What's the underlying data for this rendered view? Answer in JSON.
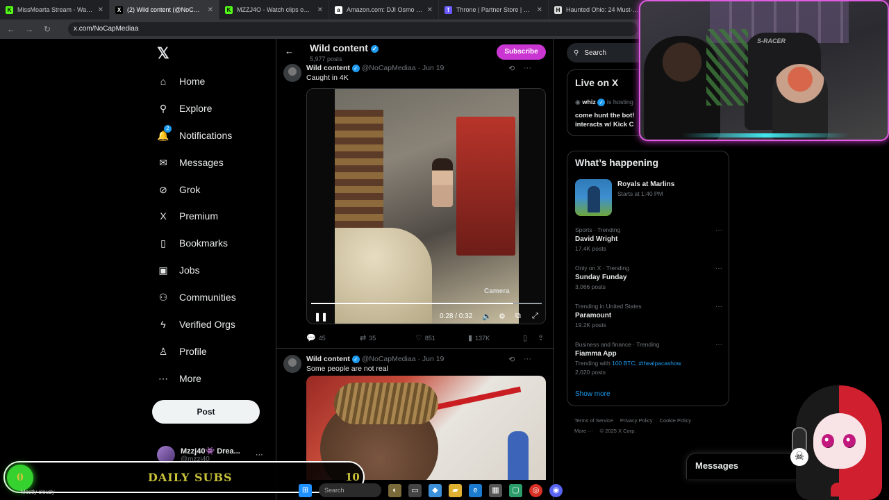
{
  "browser": {
    "tabs": [
      {
        "label": "MissMoarta Stream - Watch Live",
        "fav": "K",
        "fav_color": "#53fc18"
      },
      {
        "label": "(2) Wild content (@NoCapMediaa)",
        "fav": "X",
        "fav_color": "#000000",
        "active": true
      },
      {
        "label": "MZZJ4O - Watch clips on Kick",
        "fav": "K",
        "fav_color": "#53fc18"
      },
      {
        "label": "Amazon.com: DJI Osmo Mobile",
        "fav": "a",
        "fav_color": "#ffffff"
      },
      {
        "label": "Throne | Partner Store | Browse",
        "fav": "T",
        "fav_color": "#6b5bff"
      },
      {
        "label": "Haunted Ohio: 24 Must-Visit",
        "fav": "H",
        "fav_color": "#dddddd"
      }
    ],
    "url": "x.com/NoCapMediaa"
  },
  "nav": {
    "items": [
      {
        "label": "Home",
        "icon": "home-icon",
        "glyph": "⌂"
      },
      {
        "label": "Explore",
        "icon": "search-icon",
        "glyph": "⚲"
      },
      {
        "label": "Notifications",
        "icon": "bell-icon",
        "glyph": "🔔"
      },
      {
        "label": "Messages",
        "icon": "mail-icon",
        "glyph": "✉"
      },
      {
        "label": "Grok",
        "icon": "grok-icon",
        "glyph": "⊘"
      },
      {
        "label": "Premium",
        "icon": "x-icon",
        "glyph": "X"
      },
      {
        "label": "Bookmarks",
        "icon": "bookmark-icon",
        "glyph": "▯"
      },
      {
        "label": "Jobs",
        "icon": "briefcase-icon",
        "glyph": "▣"
      },
      {
        "label": "Communities",
        "icon": "people-icon",
        "glyph": "⚇"
      },
      {
        "label": "Verified Orgs",
        "icon": "lightning-icon",
        "glyph": "ϟ"
      },
      {
        "label": "Profile",
        "icon": "person-icon",
        "glyph": "♙"
      },
      {
        "label": "More",
        "icon": "more-circle-icon",
        "glyph": "⋯"
      }
    ],
    "notification_badge": "2",
    "post_label": "Post",
    "account_name": "Mzzj40👾 Drea...",
    "account_handle": "@mzzj40"
  },
  "header": {
    "title": "Wild content",
    "count": "5,977 posts",
    "subscribe": "Subscribe"
  },
  "tweet1": {
    "name": "Wild content",
    "handle": "@NoCapMediaa · Jun 19",
    "text": "Caught in 4K",
    "video_time": "0:28 / 0:32",
    "progress": 0.875,
    "watermark": "Camera",
    "replies": "45",
    "reposts": "35",
    "likes": "851",
    "views": "137K"
  },
  "tweet2": {
    "name": "Wild content",
    "handle": "@NoCapMediaa · Jun 19",
    "text": "Some people are not real"
  },
  "right": {
    "search_placeholder": "Search",
    "live_title": "Live on X",
    "live_host": "whiz",
    "live_hosting": "is hosting",
    "live_desc": "come hunt the bot! interacts w/ Kick C",
    "happening_title": "What’s happening",
    "event_name": "Royals at Marlins",
    "event_time": "Starts at 1:40 PM",
    "trends": [
      {
        "context": "Sports · Trending",
        "name": "David Wright",
        "posts": "17.4K posts"
      },
      {
        "context": "Only on X · Trending",
        "name": "Sunday Funday",
        "posts": "3,066 posts"
      },
      {
        "context": "Trending in United States",
        "name": "Paramount",
        "posts": "19.2K posts"
      },
      {
        "context": "Business and finance · Trending",
        "name": "Fiamma App",
        "with_label": "Trending with",
        "with_links": "100 BTC, #thealpacashow",
        "posts": "2,020 posts"
      }
    ],
    "show_more": "Show more",
    "footer": [
      "Terms of Service",
      "Privacy Policy",
      "Cookie Policy",
      "More ···",
      "© 2025 X Corp."
    ],
    "messages": "Messages"
  },
  "overlays": {
    "subs_count": "0",
    "subs_label": "DAILY SUBS",
    "subs_goal": "10",
    "chair_text": "S-RACER",
    "weather": "Mostly cloudy",
    "taskbar_search": "Search"
  }
}
